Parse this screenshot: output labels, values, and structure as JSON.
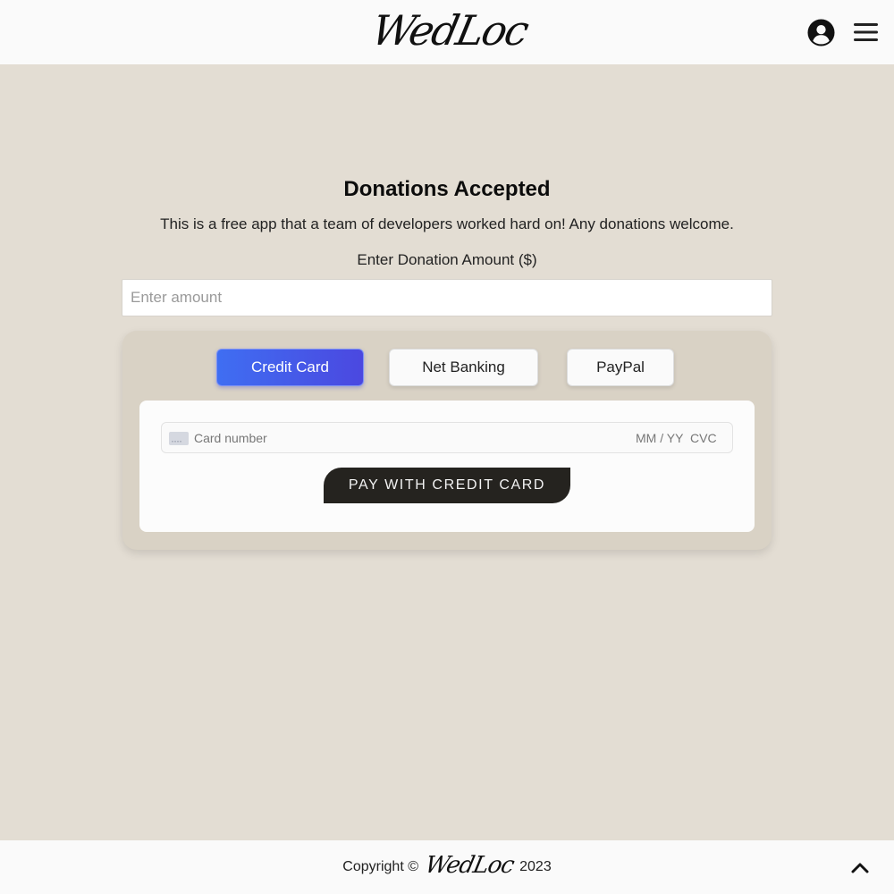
{
  "header": {
    "logo_text": "WedLoc",
    "user_icon": "user-circle-icon",
    "menu_icon": "hamburger-menu-icon"
  },
  "main": {
    "title": "Donations Accepted",
    "subtitle": "This is a free app that a team of developers worked hard on! Any donations welcome.",
    "amount_label": "Enter Donation Amount ($)",
    "amount_placeholder": "Enter amount",
    "amount_value": ""
  },
  "payment": {
    "methods": [
      {
        "label": "Credit Card",
        "selected": true
      },
      {
        "label": "Net Banking",
        "selected": false
      },
      {
        "label": "PayPal",
        "selected": false
      }
    ],
    "card_brand_icon": "credit-card-icon",
    "card_number_placeholder": "Card number",
    "expiry_placeholder": "MM / YY",
    "cvc_placeholder": "CVC",
    "pay_button_label": "PAY WITH CREDIT CARD"
  },
  "footer": {
    "copyright_prefix": "Copyright ©",
    "logo_text": "WedLoc",
    "year": "2023",
    "scroll_top_icon": "chevron-up-icon"
  },
  "colors": {
    "page_background": "#e3ddd3",
    "header_background": "#fafafa",
    "panel_background": "#d9d2c5",
    "accent_gradient_start": "#3f6ef2",
    "accent_gradient_end": "#4b48e0",
    "pay_button": "#25231f"
  }
}
